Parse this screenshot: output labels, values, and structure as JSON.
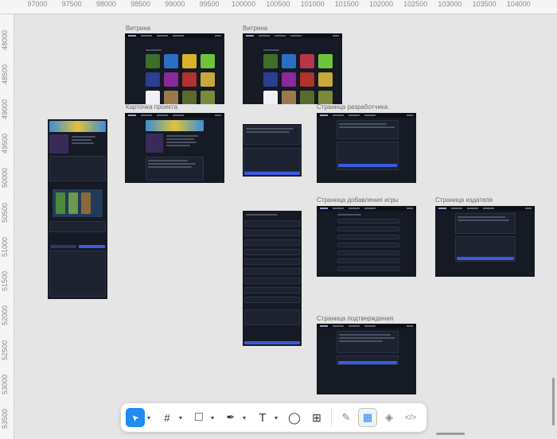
{
  "ruler": {
    "x_ticks": [
      "97000",
      "97500",
      "98000",
      "98500",
      "99000",
      "99500",
      "100000",
      "100500",
      "101000",
      "101500",
      "102000",
      "102500",
      "103000",
      "103500",
      "104000"
    ],
    "y_ticks": [
      "48000",
      "48500",
      "49000",
      "49500",
      "50000",
      "50500",
      "51000",
      "51500",
      "52000",
      "52500",
      "53000",
      "53500"
    ]
  },
  "frames": {
    "vitrina1": "Витрина",
    "vitrina2": "Витрина",
    "project_card": "Карточка проекта",
    "dev_page": "Страница разработчика",
    "add_game_page": "Страница добавления игры",
    "publisher_page": "Страница издателя",
    "confirm_page": "Страница подтверждения"
  },
  "toolbar": {
    "tools": [
      {
        "name": "move-tool",
        "icon": "pointer-icon",
        "glyph": "➤",
        "active": true
      },
      {
        "name": "frame-tool",
        "icon": "frame-icon",
        "glyph": "#"
      },
      {
        "name": "shape-tool",
        "icon": "rectangle-icon",
        "glyph": "□"
      },
      {
        "name": "pen-tool",
        "icon": "pen-icon",
        "glyph": "✒"
      },
      {
        "name": "text-tool",
        "icon": "text-icon",
        "glyph": "T"
      },
      {
        "name": "comment-tool",
        "icon": "comment-icon",
        "glyph": "◯"
      },
      {
        "name": "actions-tool",
        "icon": "actions-icon",
        "glyph": "⊞"
      }
    ],
    "modes": [
      {
        "name": "draw-mode",
        "icon": "draw-icon",
        "glyph": "✎"
      },
      {
        "name": "design-mode",
        "icon": "design-icon",
        "glyph": "▦",
        "selected": true
      },
      {
        "name": "prototype-mode",
        "icon": "prototype-icon",
        "glyph": "◈"
      },
      {
        "name": "dev-mode",
        "icon": "code-icon",
        "glyph": "</>"
      }
    ]
  },
  "colors": {
    "canvas": "#e5e5e5",
    "frame_bg": "#161a24",
    "accent": "#1f8cf5",
    "button_blue": "#3a5be0"
  }
}
